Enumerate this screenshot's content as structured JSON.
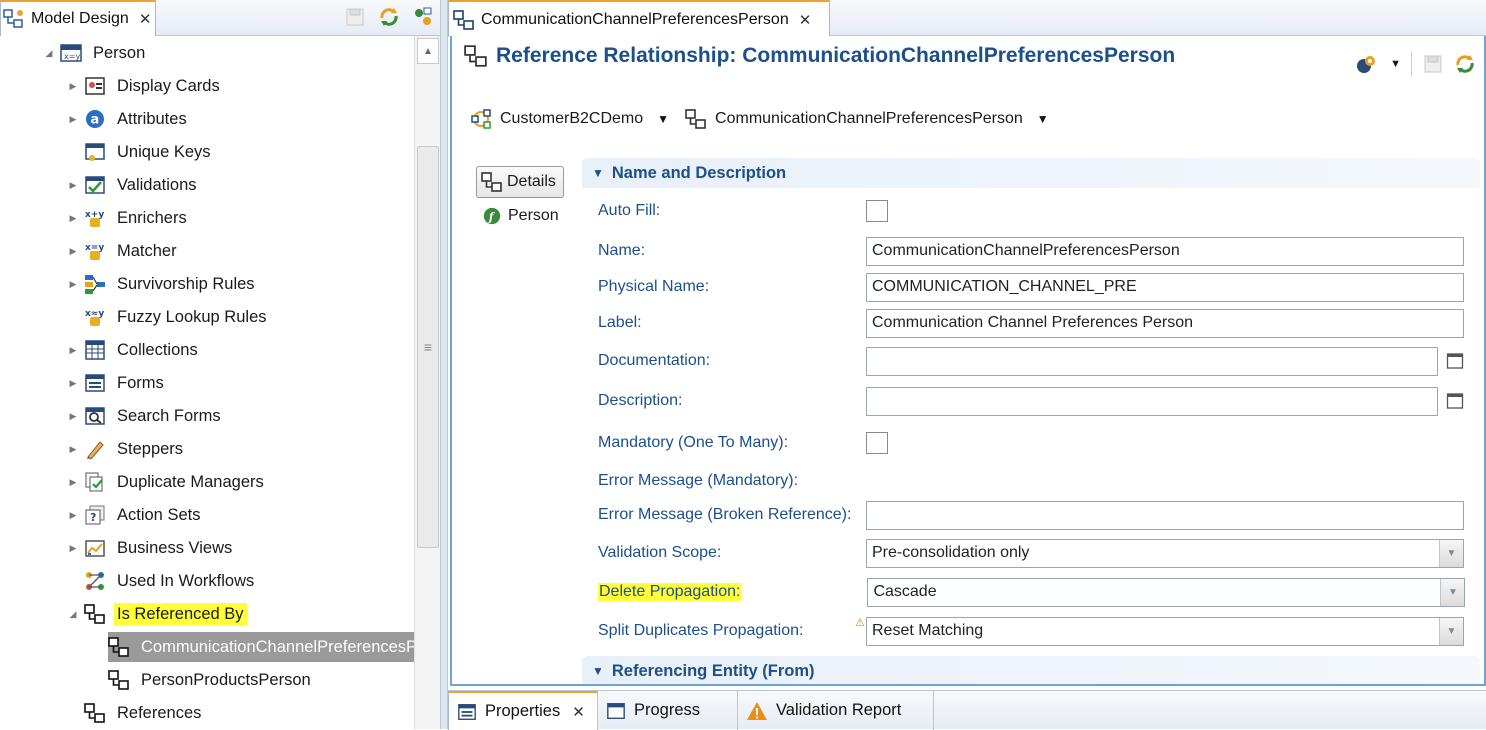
{
  "left_panel": {
    "tab_title": "Model Design",
    "tree": {
      "root": "Person",
      "items": [
        {
          "label": "Display Cards",
          "icon": "display-cards-icon",
          "expandable": true
        },
        {
          "label": "Attributes",
          "icon": "attributes-icon",
          "expandable": true
        },
        {
          "label": "Unique Keys",
          "icon": "unique-keys-icon",
          "expandable": false
        },
        {
          "label": "Validations",
          "icon": "validations-icon",
          "expandable": true
        },
        {
          "label": "Enrichers",
          "icon": "enrichers-icon",
          "expandable": true
        },
        {
          "label": "Matcher",
          "icon": "matcher-icon",
          "expandable": true
        },
        {
          "label": "Survivorship Rules",
          "icon": "survivorship-icon",
          "expandable": true
        },
        {
          "label": "Fuzzy Lookup Rules",
          "icon": "fuzzy-lookup-icon",
          "expandable": false
        },
        {
          "label": "Collections",
          "icon": "collections-icon",
          "expandable": true
        },
        {
          "label": "Forms",
          "icon": "forms-icon",
          "expandable": true
        },
        {
          "label": "Search Forms",
          "icon": "search-forms-icon",
          "expandable": true
        },
        {
          "label": "Steppers",
          "icon": "steppers-icon",
          "expandable": true
        },
        {
          "label": "Duplicate Managers",
          "icon": "duplicate-managers-icon",
          "expandable": true
        },
        {
          "label": "Action Sets",
          "icon": "action-sets-icon",
          "expandable": true
        },
        {
          "label": "Business Views",
          "icon": "business-views-icon",
          "expandable": true
        },
        {
          "label": "Used In Workflows",
          "icon": "workflows-icon",
          "expandable": false
        },
        {
          "label": "Is Referenced By",
          "icon": "reference-icon",
          "expandable": true,
          "expanded": true,
          "highlighted": true
        }
      ],
      "referenced_by_children": [
        {
          "label": "CommunicationChannelPreferencesPe",
          "selected": true
        },
        {
          "label": "PersonProductsPerson",
          "selected": false
        }
      ],
      "references_label": "References"
    }
  },
  "editor": {
    "tab_title": "CommunicationChannelPreferencesPerson",
    "page_title": "Reference Relationship: CommunicationChannelPreferencesPerson",
    "breadcrumb": {
      "model": "CustomerB2CDemo",
      "relationship": "CommunicationChannelPreferencesPerson"
    },
    "side_nav": {
      "details_label": "Details",
      "person_label": "Person"
    },
    "section_name_desc": "Name and Description",
    "section_referencing": "Referencing Entity (From)",
    "fields": {
      "auto_fill_label": "Auto Fill:",
      "name_label": "Name:",
      "name_value": "CommunicationChannelPreferencesPerson",
      "physical_name_label": "Physical Name:",
      "physical_name_value": "COMMUNICATION_CHANNEL_PRE",
      "label_label": "Label:",
      "label_value": "Communication Channel Preferences Person",
      "documentation_label": "Documentation:",
      "documentation_value": "",
      "description_label": "Description:",
      "description_value": "",
      "mandatory_label": "Mandatory (One To Many):",
      "error_mandatory_label": "Error Message (Mandatory):",
      "error_broken_label": "Error Message (Broken Reference):",
      "error_broken_value": "",
      "validation_scope_label": "Validation Scope:",
      "validation_scope_value": "Pre-consolidation only",
      "delete_propagation_label": "Delete Propagation:",
      "delete_propagation_value": "Cascade",
      "split_dup_label": "Split Duplicates Propagation:",
      "split_dup_value": "Reset Matching"
    }
  },
  "bottom_tabs": {
    "properties": "Properties",
    "progress": "Progress",
    "validation_report": "Validation Report"
  },
  "colors": {
    "accent_blue": "#1d4f8a",
    "highlight": "#ffff3a",
    "selection": "#9a9a9a",
    "tab_accent": "#f0a030"
  }
}
